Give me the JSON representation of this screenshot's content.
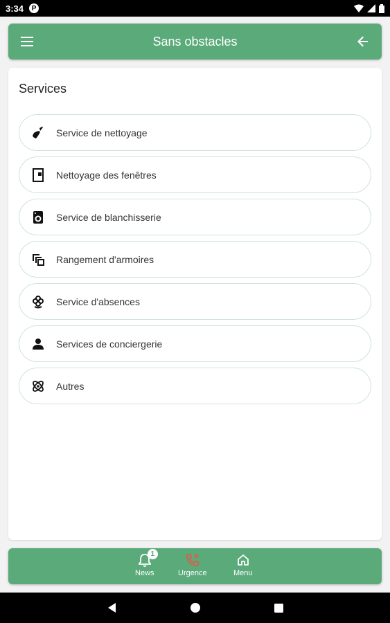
{
  "status_bar": {
    "time": "3:34",
    "notif_letter": "P"
  },
  "app_bar": {
    "title": "Sans obstacles"
  },
  "services": {
    "title": "Services",
    "items": [
      {
        "label": "Service de nettoyage",
        "icon": "broom-icon"
      },
      {
        "label": "Nettoyage des fenêtres",
        "icon": "window-icon"
      },
      {
        "label": "Service de blanchisserie",
        "icon": "washing-machine-icon"
      },
      {
        "label": "Rangement d'armoires",
        "icon": "filter-stack-icon"
      },
      {
        "label": "Service d'absences",
        "icon": "flower-icon"
      },
      {
        "label": "Services de conciergerie",
        "icon": "person-icon"
      },
      {
        "label": "Autres",
        "icon": "atom-icon"
      }
    ]
  },
  "bottom_nav": {
    "news_label": "News",
    "news_badge": "1",
    "urgence_label": "Urgence",
    "menu_label": "Menu"
  },
  "colors": {
    "primary": "#5aaa7a",
    "urgence_icon": "#e05a4f",
    "card_border": "#cfe3d8"
  }
}
